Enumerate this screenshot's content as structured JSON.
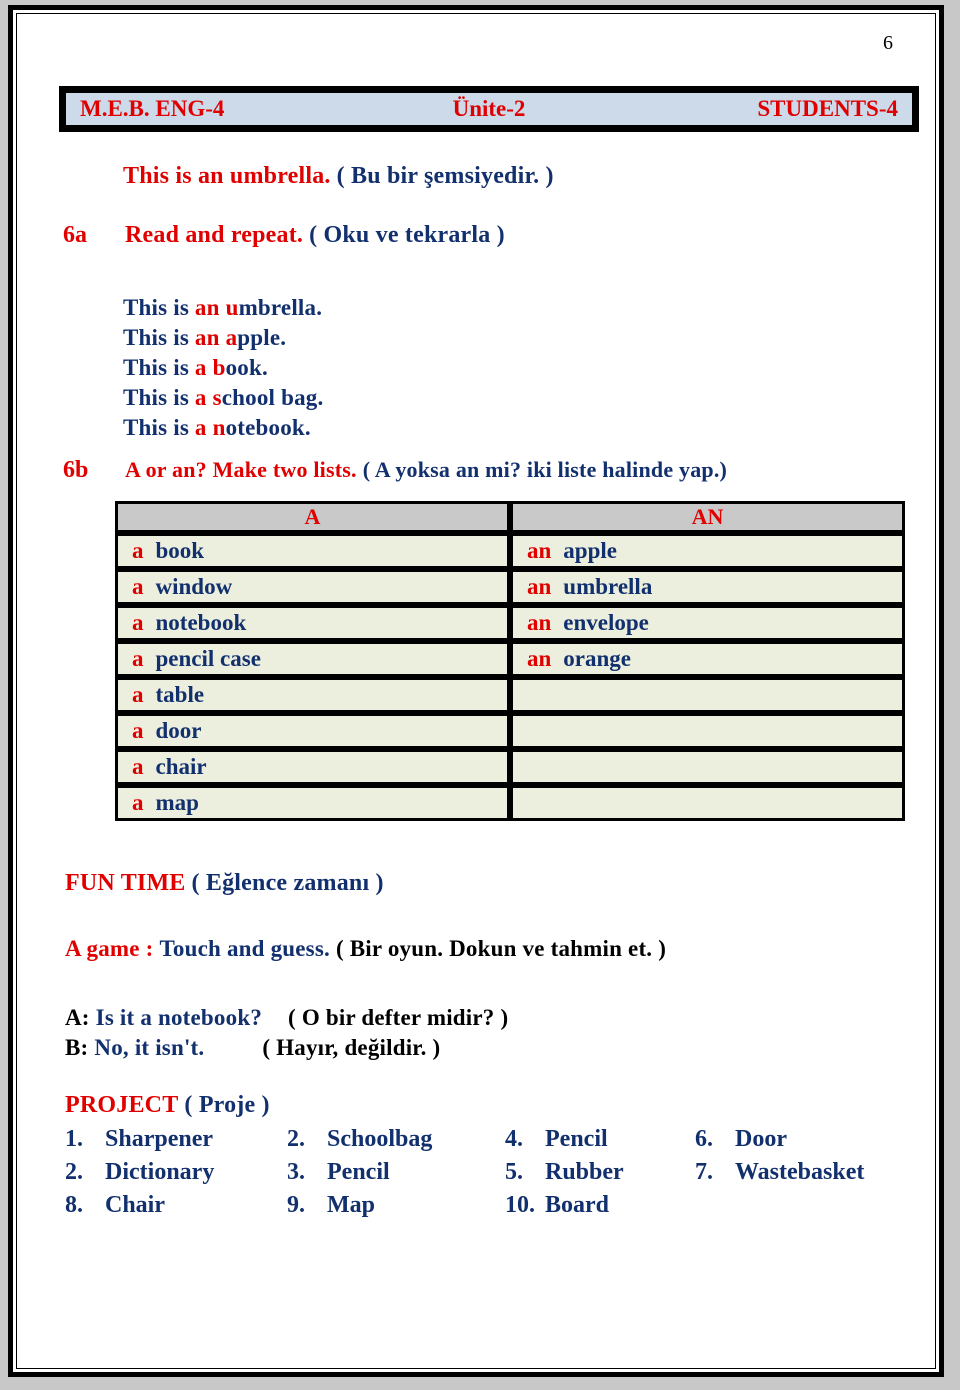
{
  "page": {
    "number": "6"
  },
  "header": {
    "left": "M.E.B. ENG-4",
    "center": "Ünite-2",
    "right": "STUDENTS-4"
  },
  "intro": {
    "english": "This is an umbrella.",
    "turkish": "( Bu bir şemsiyedir. )"
  },
  "exercise_6a": {
    "marker": "6a",
    "instruction_en": "Read and repeat.",
    "instruction_tr": "( Oku ve tekrarla )",
    "sentences": [
      {
        "lead": "This is ",
        "article": "an u",
        "rest": "mbrella."
      },
      {
        "lead": "This is ",
        "article": "an a",
        "rest": "pple."
      },
      {
        "lead": "This is ",
        "article": "a b",
        "rest": "ook."
      },
      {
        "lead": "This is ",
        "article": "a s",
        "rest": "chool bag."
      },
      {
        "lead": "This is ",
        "article": "a n",
        "rest": "otebook."
      }
    ]
  },
  "exercise_6b": {
    "marker": "6b",
    "instruction_en": "A or an? Make two lists.",
    "instruction_tr": "( A yoksa an mi? iki liste halinde yap.)",
    "table": {
      "headers": [
        "A",
        "AN"
      ],
      "rows": [
        {
          "a_article": "a",
          "a_word": "book",
          "an_article": "an",
          "an_word": "apple"
        },
        {
          "a_article": "a",
          "a_word": "window",
          "an_article": "an",
          "an_word": "umbrella"
        },
        {
          "a_article": "a",
          "a_word": "notebook",
          "an_article": "an",
          "an_word": "envelope"
        },
        {
          "a_article": "a",
          "a_word": "pencil  case",
          "an_article": "an",
          "an_word": "orange"
        },
        {
          "a_article": "a",
          "a_word": "table",
          "an_article": "",
          "an_word": ""
        },
        {
          "a_article": "a",
          "a_word": "door",
          "an_article": "",
          "an_word": ""
        },
        {
          "a_article": "a",
          "a_word": "chair",
          "an_article": "",
          "an_word": ""
        },
        {
          "a_article": "a",
          "a_word": "map",
          "an_article": "",
          "an_word": ""
        }
      ]
    }
  },
  "fun_time": {
    "title_en": "FUN  TIME",
    "title_tr": "( Eğlence  zamanı )",
    "game_label_en": "A game :",
    "game_text_en": "Touch  and  guess.",
    "game_text_tr": "( Bir  oyun. Dokun  ve  tahmin et. )",
    "dialogue": [
      {
        "speaker": "A:",
        "english": "Is it a  notebook?",
        "turkish": "( O bir  defter  midir? )"
      },
      {
        "speaker": "B:",
        "english": "No,  it  isn't.",
        "turkish": "( Hayır,  değildir.      )"
      }
    ]
  },
  "project": {
    "title_en": "PROJECT",
    "title_tr": "( Proje )",
    "rows": [
      [
        {
          "num": "1.",
          "label": "Sharpener"
        },
        {
          "num": "2.",
          "label": "Schoolbag"
        },
        {
          "num": "4.",
          "label": "Pencil"
        },
        {
          "num": "6.",
          "label": "Door"
        }
      ],
      [
        {
          "num": "2.",
          "label": "Dictionary"
        },
        {
          "num": "3.",
          "label": "Pencil"
        },
        {
          "num": "5.",
          "label": "Rubber"
        },
        {
          "num": "7.",
          "label": "Wastebasket"
        }
      ],
      [
        {
          "num": "8.",
          "label": "Chair"
        },
        {
          "num": "9.",
          "label": "Map"
        },
        {
          "num": "10.",
          "label": "Board"
        },
        {
          "num": "",
          "label": ""
        }
      ]
    ]
  },
  "colors": {
    "red": "#e00000",
    "navy": "#12306e",
    "header_band": "#ccdaea",
    "table_header_bg": "#c9c9c9",
    "table_row_bg": "#ecefdd"
  }
}
